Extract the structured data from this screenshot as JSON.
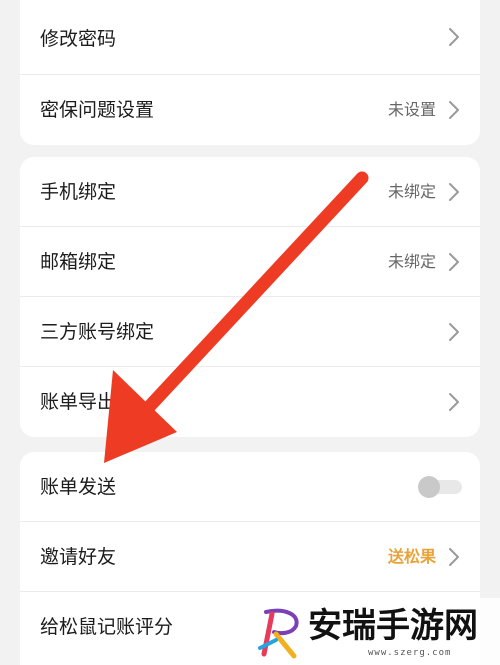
{
  "groups": [
    {
      "rows": [
        {
          "label": "修改密码",
          "value": ""
        },
        {
          "label": "密保问题设置",
          "value": "未设置"
        }
      ]
    },
    {
      "rows": [
        {
          "label": "手机绑定",
          "value": "未绑定"
        },
        {
          "label": "邮箱绑定",
          "value": "未绑定"
        },
        {
          "label": "三方账号绑定",
          "value": ""
        },
        {
          "label": "账单导出",
          "value": ""
        }
      ]
    },
    {
      "rows": [
        {
          "label": "账单发送",
          "toggle": false
        },
        {
          "label": "邀请好友",
          "value": "送松果"
        },
        {
          "label": "给松鼠记账评分",
          "value": ""
        }
      ]
    }
  ],
  "watermark": {
    "text": "安瑞手游网",
    "url": "www.szerg.com"
  },
  "colors": {
    "background": "#f2f2f2",
    "card": "#ffffff",
    "accent_value": "#e8a33a",
    "annotation_arrow": "#ee3b24"
  },
  "icons": {
    "chevron": "chevron-right-icon",
    "arrow": "annotation-arrow-icon",
    "logo": "watermark-logo-icon"
  }
}
